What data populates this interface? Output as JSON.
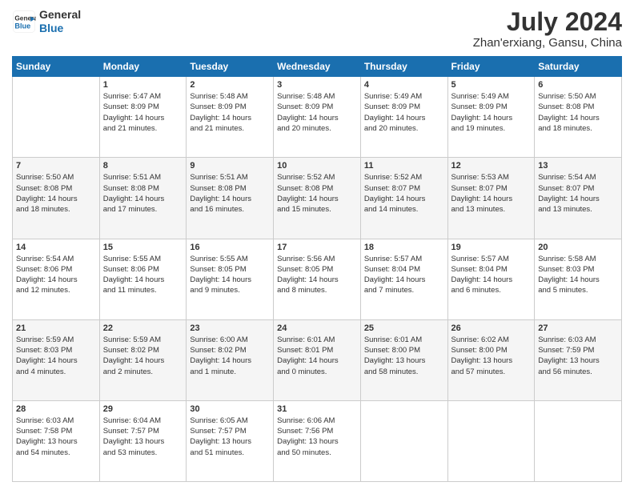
{
  "header": {
    "logo_line1": "General",
    "logo_line2": "Blue",
    "month_year": "July 2024",
    "location": "Zhan'erxiang, Gansu, China"
  },
  "days_of_week": [
    "Sunday",
    "Monday",
    "Tuesday",
    "Wednesday",
    "Thursday",
    "Friday",
    "Saturday"
  ],
  "weeks": [
    [
      {
        "day": "",
        "info": ""
      },
      {
        "day": "1",
        "info": "Sunrise: 5:47 AM\nSunset: 8:09 PM\nDaylight: 14 hours\nand 21 minutes."
      },
      {
        "day": "2",
        "info": "Sunrise: 5:48 AM\nSunset: 8:09 PM\nDaylight: 14 hours\nand 21 minutes."
      },
      {
        "day": "3",
        "info": "Sunrise: 5:48 AM\nSunset: 8:09 PM\nDaylight: 14 hours\nand 20 minutes."
      },
      {
        "day": "4",
        "info": "Sunrise: 5:49 AM\nSunset: 8:09 PM\nDaylight: 14 hours\nand 20 minutes."
      },
      {
        "day": "5",
        "info": "Sunrise: 5:49 AM\nSunset: 8:09 PM\nDaylight: 14 hours\nand 19 minutes."
      },
      {
        "day": "6",
        "info": "Sunrise: 5:50 AM\nSunset: 8:08 PM\nDaylight: 14 hours\nand 18 minutes."
      }
    ],
    [
      {
        "day": "7",
        "info": "Sunrise: 5:50 AM\nSunset: 8:08 PM\nDaylight: 14 hours\nand 18 minutes."
      },
      {
        "day": "8",
        "info": "Sunrise: 5:51 AM\nSunset: 8:08 PM\nDaylight: 14 hours\nand 17 minutes."
      },
      {
        "day": "9",
        "info": "Sunrise: 5:51 AM\nSunset: 8:08 PM\nDaylight: 14 hours\nand 16 minutes."
      },
      {
        "day": "10",
        "info": "Sunrise: 5:52 AM\nSunset: 8:08 PM\nDaylight: 14 hours\nand 15 minutes."
      },
      {
        "day": "11",
        "info": "Sunrise: 5:52 AM\nSunset: 8:07 PM\nDaylight: 14 hours\nand 14 minutes."
      },
      {
        "day": "12",
        "info": "Sunrise: 5:53 AM\nSunset: 8:07 PM\nDaylight: 14 hours\nand 13 minutes."
      },
      {
        "day": "13",
        "info": "Sunrise: 5:54 AM\nSunset: 8:07 PM\nDaylight: 14 hours\nand 13 minutes."
      }
    ],
    [
      {
        "day": "14",
        "info": "Sunrise: 5:54 AM\nSunset: 8:06 PM\nDaylight: 14 hours\nand 12 minutes."
      },
      {
        "day": "15",
        "info": "Sunrise: 5:55 AM\nSunset: 8:06 PM\nDaylight: 14 hours\nand 11 minutes."
      },
      {
        "day": "16",
        "info": "Sunrise: 5:55 AM\nSunset: 8:05 PM\nDaylight: 14 hours\nand 9 minutes."
      },
      {
        "day": "17",
        "info": "Sunrise: 5:56 AM\nSunset: 8:05 PM\nDaylight: 14 hours\nand 8 minutes."
      },
      {
        "day": "18",
        "info": "Sunrise: 5:57 AM\nSunset: 8:04 PM\nDaylight: 14 hours\nand 7 minutes."
      },
      {
        "day": "19",
        "info": "Sunrise: 5:57 AM\nSunset: 8:04 PM\nDaylight: 14 hours\nand 6 minutes."
      },
      {
        "day": "20",
        "info": "Sunrise: 5:58 AM\nSunset: 8:03 PM\nDaylight: 14 hours\nand 5 minutes."
      }
    ],
    [
      {
        "day": "21",
        "info": "Sunrise: 5:59 AM\nSunset: 8:03 PM\nDaylight: 14 hours\nand 4 minutes."
      },
      {
        "day": "22",
        "info": "Sunrise: 5:59 AM\nSunset: 8:02 PM\nDaylight: 14 hours\nand 2 minutes."
      },
      {
        "day": "23",
        "info": "Sunrise: 6:00 AM\nSunset: 8:02 PM\nDaylight: 14 hours\nand 1 minute."
      },
      {
        "day": "24",
        "info": "Sunrise: 6:01 AM\nSunset: 8:01 PM\nDaylight: 14 hours\nand 0 minutes."
      },
      {
        "day": "25",
        "info": "Sunrise: 6:01 AM\nSunset: 8:00 PM\nDaylight: 13 hours\nand 58 minutes."
      },
      {
        "day": "26",
        "info": "Sunrise: 6:02 AM\nSunset: 8:00 PM\nDaylight: 13 hours\nand 57 minutes."
      },
      {
        "day": "27",
        "info": "Sunrise: 6:03 AM\nSunset: 7:59 PM\nDaylight: 13 hours\nand 56 minutes."
      }
    ],
    [
      {
        "day": "28",
        "info": "Sunrise: 6:03 AM\nSunset: 7:58 PM\nDaylight: 13 hours\nand 54 minutes."
      },
      {
        "day": "29",
        "info": "Sunrise: 6:04 AM\nSunset: 7:57 PM\nDaylight: 13 hours\nand 53 minutes."
      },
      {
        "day": "30",
        "info": "Sunrise: 6:05 AM\nSunset: 7:57 PM\nDaylight: 13 hours\nand 51 minutes."
      },
      {
        "day": "31",
        "info": "Sunrise: 6:06 AM\nSunset: 7:56 PM\nDaylight: 13 hours\nand 50 minutes."
      },
      {
        "day": "",
        "info": ""
      },
      {
        "day": "",
        "info": ""
      },
      {
        "day": "",
        "info": ""
      }
    ]
  ]
}
